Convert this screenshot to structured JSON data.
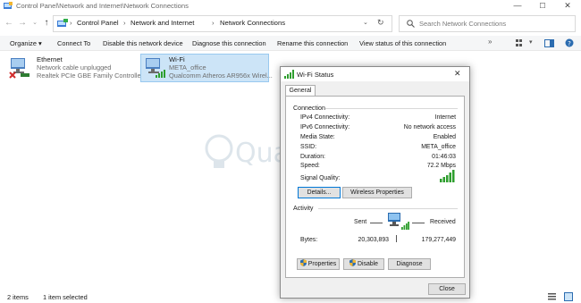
{
  "window": {
    "title": "Control Panel\\Network and Internet\\Network Connections",
    "controls": {
      "minimize": "—",
      "maximize": "☐",
      "close": "✕"
    }
  },
  "address": {
    "breadcrumb": [
      "Control Panel",
      "Network and Internet",
      "Network Connections"
    ],
    "separator": "›",
    "search_placeholder": "Search Network Connections"
  },
  "toolbar": {
    "organize": "Organize ▾",
    "connect_to": "Connect To",
    "disable": "Disable this network device",
    "diagnose": "Diagnose this connection",
    "rename": "Rename this connection",
    "view_status": "View status of this connection"
  },
  "connections": [
    {
      "name": "Ethernet",
      "status": "Network cable unplugged",
      "adapter": "Realtek PCIe GBE Family Controller"
    },
    {
      "name": "Wi-Fi",
      "status": "META_office",
      "adapter": "Qualcomm Atheros AR956x Wirel..."
    }
  ],
  "statusbar": {
    "count": "2 items",
    "selected": "1 item selected"
  },
  "watermark": {
    "text": "Quantrimang"
  },
  "dialog": {
    "title": "Wi-Fi Status",
    "close": "✕",
    "tab": "General",
    "connection_heading": "Connection",
    "fields": [
      {
        "label": "IPv4 Connectivity:",
        "value": "Internet"
      },
      {
        "label": "IPv6 Connectivity:",
        "value": "No network access"
      },
      {
        "label": "Media State:",
        "value": "Enabled"
      },
      {
        "label": "SSID:",
        "value": "META_office"
      },
      {
        "label": "Duration:",
        "value": "01:46:03"
      },
      {
        "label": "Speed:",
        "value": "72.2 Mbps"
      }
    ],
    "signal_label": "Signal Quality:",
    "details_btn": "Details...",
    "wireless_btn": "Wireless Properties",
    "activity_heading": "Activity",
    "sent_label": "Sent",
    "received_label": "Received",
    "bytes_label": "Bytes:",
    "bytes_sent": "20,303,893",
    "bytes_received": "179,277,449",
    "properties_btn": "Properties",
    "disable_btn": "Disable",
    "diagnose_btn": "Diagnose",
    "close_btn": "Close"
  },
  "colors": {
    "accent": "#0078d7",
    "selection": "#cce4f7",
    "signal": "#2e9e2e"
  }
}
